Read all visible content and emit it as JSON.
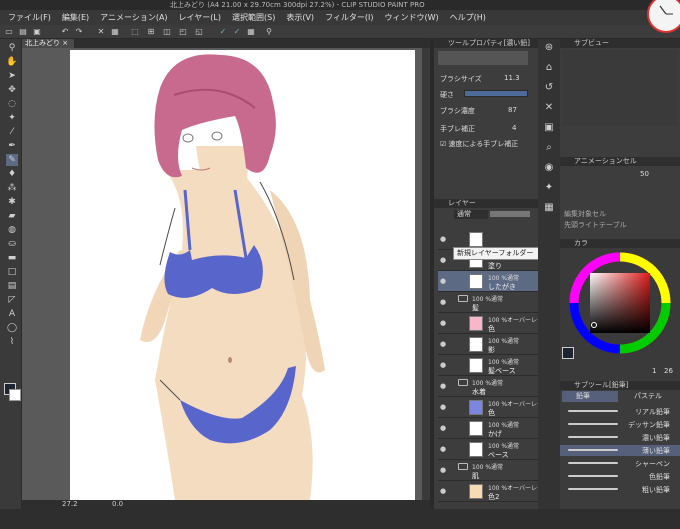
{
  "window": {
    "title": "北上みどり (A4 21.00 x 29.70cm 300dpi 27.2%) - CLIP STUDIO PAINT PRO"
  },
  "menu": [
    "ファイル(F)",
    "編集(E)",
    "アニメーション(A)",
    "レイヤー(L)",
    "選択範囲(S)",
    "表示(V)",
    "フィルター(I)",
    "ウィンドウ(W)",
    "ヘルプ(H)"
  ],
  "document": {
    "tab_label": "北上みどり",
    "zoom": "27.2",
    "angle": "0.0"
  },
  "tool_property": {
    "header": "ツールプロパティ[濃い鉛]",
    "brush_size_label": "ブラシサイズ",
    "brush_size_value": "11.3",
    "hardness_label": "硬さ",
    "density_label": "ブラシ濃度",
    "density_value": "87",
    "stabilization_label": "手ブレ補正",
    "stabilization_value": "4",
    "speed_stab_label": "速度による手ブレ補正"
  },
  "layer_panel": {
    "tab_label": "レイヤー",
    "blend_mode": "通常",
    "tooltip": "新規レイヤーフォルダー",
    "layers": [
      {
        "mode": "",
        "name": "",
        "kind": "sketch"
      },
      {
        "mode": "100 %通常",
        "name": "塗り",
        "kind": "layer"
      },
      {
        "mode": "100 %通常",
        "name": "したがき",
        "kind": "layer",
        "selected": true
      },
      {
        "mode": "100 %通常",
        "name": "髪",
        "kind": "folder"
      },
      {
        "mode": "100 %オーバーレイ",
        "name": "色",
        "kind": "pink"
      },
      {
        "mode": "100 %通常",
        "name": "影",
        "kind": "layer"
      },
      {
        "mode": "100 %通常",
        "name": "髪ベース",
        "kind": "layer"
      },
      {
        "mode": "100 %通常",
        "name": "水着",
        "kind": "folder"
      },
      {
        "mode": "100 %オーバーレイ",
        "name": "色",
        "kind": "blue"
      },
      {
        "mode": "100 %通常",
        "name": "かげ",
        "kind": "layer"
      },
      {
        "mode": "100 %通常",
        "name": "ベース",
        "kind": "layer"
      },
      {
        "mode": "100 %通常",
        "name": "肌",
        "kind": "folder"
      },
      {
        "mode": "100 %オーバーレイ",
        "name": "色2",
        "kind": "skin"
      }
    ]
  },
  "navigator": {
    "header": "サブビュー"
  },
  "animation_cel": {
    "header": "アニメーションセル",
    "frame": "50",
    "label1": "編集対象セル",
    "label2": "先頭ライトテーブル"
  },
  "color_panel": {
    "header": "カラ",
    "values": [
      "1",
      "26"
    ]
  },
  "subtool": {
    "header": "サブツール[鉛筆]",
    "tab_pencil": "鉛筆",
    "tab_pastel": "パステル",
    "brushes": [
      "リアル鉛筆",
      "デッサン鉛筆",
      "濃い鉛筆",
      "薄い鉛筆",
      "シャーペン",
      "色鉛筆",
      "粗い鉛筆"
    ],
    "selected_index": 3
  },
  "colors": {
    "accent": "#5d6a84",
    "hair": "#c86a8e",
    "bikini": "#5866cc",
    "skin": "#f4dcc0",
    "main_color": "#1f2433"
  }
}
